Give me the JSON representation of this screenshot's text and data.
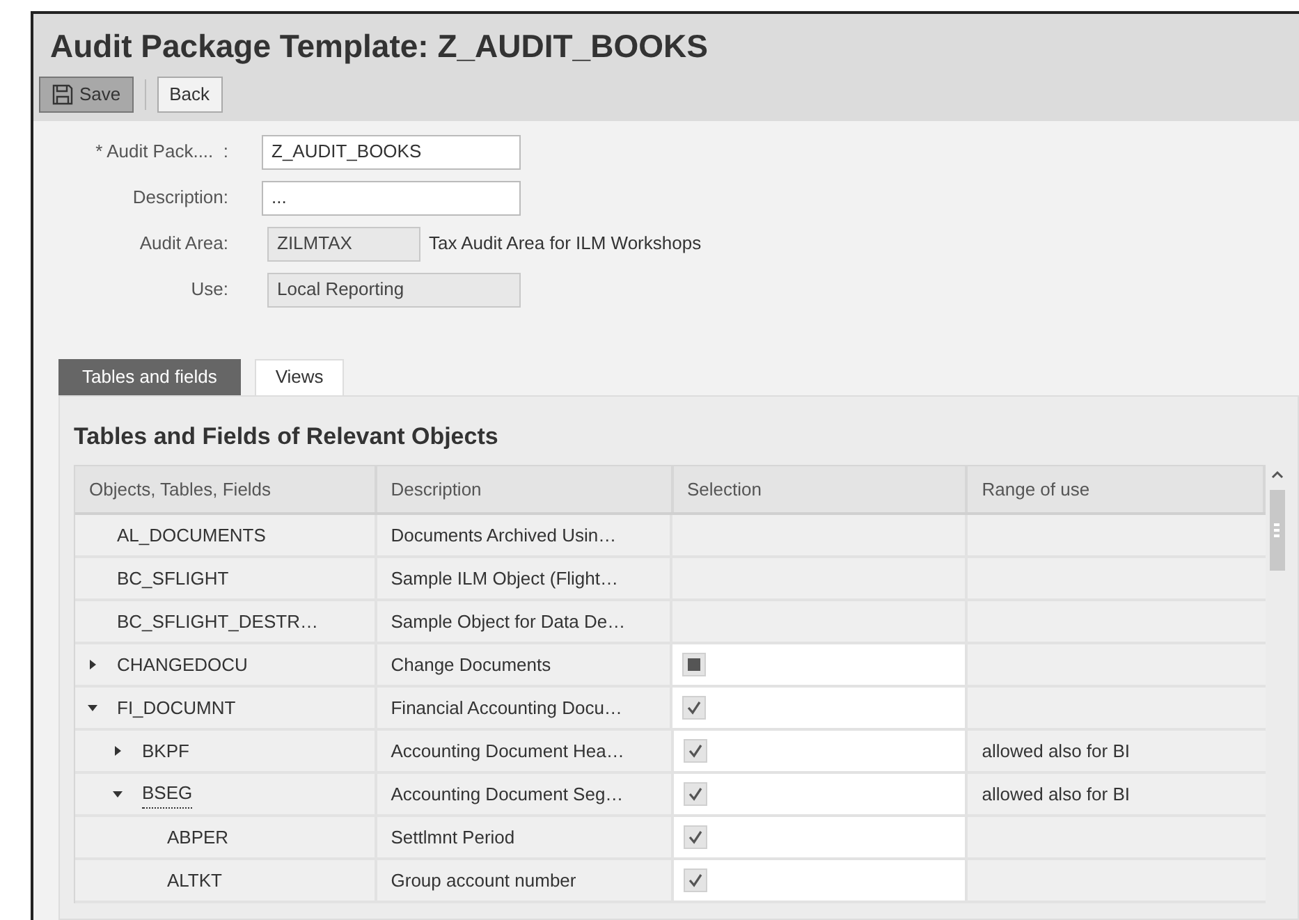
{
  "window": {
    "title": "Audit Package Template: Z_AUDIT_BOOKS"
  },
  "toolbar": {
    "buttons": [
      {
        "label": "Save",
        "kind": "save",
        "selected": true
      },
      {
        "label": "Back",
        "kind": "plain",
        "selected": false
      }
    ]
  },
  "form": {
    "fields": [
      {
        "label": "* Audit Pack....  :",
        "value": "Z_AUDIT_BOOKS",
        "editable": true
      },
      {
        "label": "Description:",
        "value": "...",
        "editable": true
      },
      {
        "label": "Audit Area:",
        "value": "ZILMTAX",
        "editable": false,
        "note": "Tax Audit Area for ILM Workshops"
      },
      {
        "label": "Use:",
        "value": "Local Reporting",
        "editable": false
      }
    ]
  },
  "tabs": [
    {
      "label": "Tables and fields",
      "selected": true
    },
    {
      "label": "Views",
      "selected": false
    }
  ],
  "table": {
    "title": "Tables and Fields of Relevant Objects",
    "columns": [
      "Objects, Tables, Fields",
      "Description",
      "Selection",
      "Range of use"
    ],
    "rows": [
      {
        "name": "AL_DOCUMENTS",
        "description": "Documents Archived Usin…",
        "focused": false
      },
      {
        "name": "BC_SFLIGHT",
        "description": "Sample ILM Object (Flight…",
        "focused": false
      },
      {
        "name": "BC_SFLIGHT_DESTR…",
        "description": "Sample Object for Data De…",
        "focused": false
      },
      {
        "name": "CHANGEDOCU",
        "description": "Change Documents",
        "checked": false,
        "partial": true,
        "expanded": false,
        "focused": false
      },
      {
        "name": "FI_DOCUMNT",
        "description": "Financial Accounting Docu…",
        "checked": true,
        "expanded": true,
        "focused": false,
        "children": [
          {
            "name": "BKPF",
            "description": "Accounting Document Hea…",
            "checked": true,
            "expanded": false,
            "focused": false,
            "range": "allowed also for BI"
          },
          {
            "name": "BSEG",
            "description": "Accounting Document Seg…",
            "checked": true,
            "expanded": true,
            "focused": true,
            "range": "allowed also for BI",
            "children": [
              {
                "name": "ABPER",
                "description": "Settlmnt Period",
                "checked": true,
                "focused": false
              },
              {
                "name": "ALTKT",
                "description": "Group account number",
                "checked": true,
                "focused": false
              }
            ]
          }
        ]
      }
    ]
  }
}
